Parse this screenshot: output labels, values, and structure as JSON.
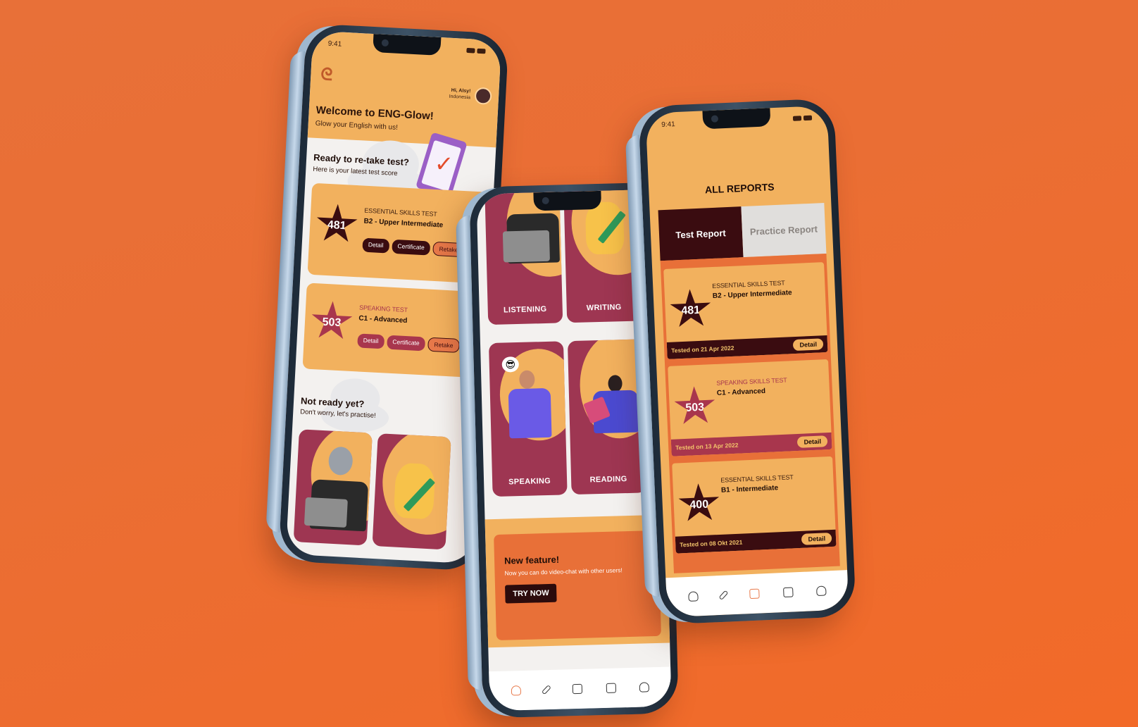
{
  "phone_home": {
    "time": "9:41",
    "greeting": "Hi, Alsy!",
    "country": "Indonesia",
    "welcome_title": "Welcome to ENG-Glow!",
    "welcome_subtitle": "Glow your English with us!",
    "retake_title": "Ready to re-take test?",
    "retake_subtitle": "Here is your latest test score",
    "scores": [
      {
        "score": "481",
        "test": "ESSENTIAL SKILLS TEST",
        "level": "B2 - Upper Intermediate"
      },
      {
        "score": "503",
        "test": "SPEAKING TEST",
        "level": "C1 - Advanced"
      }
    ],
    "buttons": {
      "detail": "Detail",
      "certificate": "Certificate",
      "retake": "Retake"
    },
    "practice_title": "Not ready yet?",
    "practice_subtitle": "Don't worry, let's practise!"
  },
  "phone_practice": {
    "tiles": [
      "LISTENING",
      "WRITING",
      "SPEAKING",
      "READING"
    ],
    "feature_title": "New feature!",
    "feature_text": "Now you can do video-chat with other users!",
    "feature_button": "TRY NOW"
  },
  "phone_reports": {
    "time": "9:41",
    "title": "ALL REPORTS",
    "tabs": [
      "Test Report",
      "Practice Report"
    ],
    "reports": [
      {
        "score": "481",
        "test": "ESSENTIAL SKILLS TEST",
        "level": "B2 - Upper Intermediate",
        "date": "Tested on 21 Apr 2022"
      },
      {
        "score": "503",
        "test": "SPEAKING SKILLS TEST",
        "level": "C1 - Advanced",
        "date": "Tested on 13 Apr 2022"
      },
      {
        "score": "400",
        "test": "ESSENTIAL SKILLS TEST",
        "level": "B1 - Intermediate",
        "date": "Tested on 08 Okt 2021"
      }
    ],
    "detail_label": "Detail"
  },
  "nav_icons": [
    "home-icon",
    "pen-icon",
    "clipboard-check-icon",
    "chat-icon",
    "profile-icon"
  ],
  "colors": {
    "background": "#ea6e34",
    "accent": "#f2b15e",
    "dark": "#3a0c10",
    "maroon": "#a8364d"
  }
}
